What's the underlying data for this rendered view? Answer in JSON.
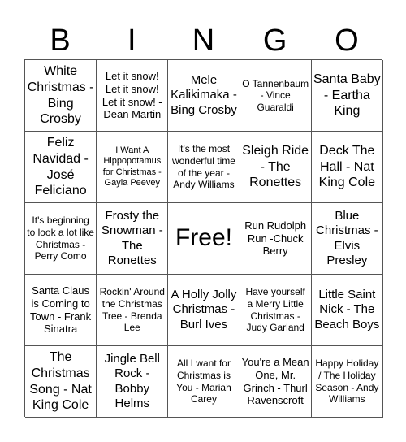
{
  "header": {
    "letters": [
      "B",
      "I",
      "N",
      "G",
      "O"
    ]
  },
  "cells": [
    {
      "text": "White Christmas - Bing Crosby",
      "size": "s16"
    },
    {
      "text": "Let it snow! Let it snow! Let it snow! - Dean Martin",
      "size": "s13"
    },
    {
      "text": "Mele Kalikimaka - Bing Crosby",
      "size": "s15"
    },
    {
      "text": "O Tannenbaum - Vince Guaraldi",
      "size": "s12"
    },
    {
      "text": "Santa Baby - Eartha King",
      "size": "s16"
    },
    {
      "text": "Feliz Navidad - José Feliciano",
      "size": "s16"
    },
    {
      "text": "I Want A Hippopotamus for Christmas -Gayla Peevey",
      "size": "s11"
    },
    {
      "text": "It's the most wonderful time of the year - Andy Williams",
      "size": "s12"
    },
    {
      "text": "Sleigh Ride - The Ronettes",
      "size": "s16"
    },
    {
      "text": "Deck The Hall - Nat King Cole",
      "size": "s16"
    },
    {
      "text": "It's beginning to look a lot like Christmas - Perry Como",
      "size": "s12"
    },
    {
      "text": "Frosty the Snowman - The Ronettes",
      "size": "s15"
    },
    {
      "text": "Free!",
      "size": "free"
    },
    {
      "text": "Run Rudolph Run -Chuck Berry",
      "size": "s13"
    },
    {
      "text": "Blue Christmas -Elvis Presley",
      "size": "s15"
    },
    {
      "text": "Santa Claus is Coming to Town - Frank Sinatra",
      "size": "s13"
    },
    {
      "text": "Rockin' Around the Christmas Tree - Brenda Lee",
      "size": "s12"
    },
    {
      "text": "A Holly Jolly Christmas - Burl Ives",
      "size": "s15"
    },
    {
      "text": "Have yourself a Merry Little Christmas - Judy Garland",
      "size": "s12"
    },
    {
      "text": "Little Saint Nick - The Beach Boys",
      "size": "s15"
    },
    {
      "text": "The Christmas Song - Nat King Cole",
      "size": "s16"
    },
    {
      "text": "Jingle Bell Rock - Bobby Helms",
      "size": "s15"
    },
    {
      "text": "All I want for Christmas is You - Mariah Carey",
      "size": "s12"
    },
    {
      "text": "You're a Mean One, Mr. Grinch - Thurl Ravenscroft",
      "size": "s13"
    },
    {
      "text": "Happy Holiday / The Holiday Season - Andy Williams",
      "size": "s12"
    }
  ]
}
